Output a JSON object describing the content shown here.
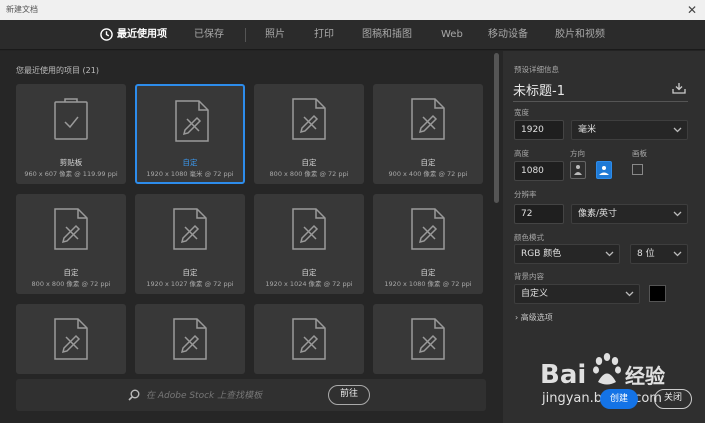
{
  "window": {
    "title": "新建文档"
  },
  "tabs": [
    {
      "label": "最近使用项",
      "active": true
    },
    {
      "label": "已保存"
    },
    {
      "label": "照片"
    },
    {
      "label": "打印"
    },
    {
      "label": "图稿和插图"
    },
    {
      "label": "Web"
    },
    {
      "label": "移动设备"
    },
    {
      "label": "胶片和视频"
    }
  ],
  "recent": {
    "title": "您最近使用的项目",
    "count": "(21)",
    "items": [
      {
        "name": "剪贴板",
        "desc": "960 x 607 像素 @ 119.99 ppi",
        "icon": "clipboard-icon"
      },
      {
        "name": "自定",
        "desc": "1920 x 1080 毫米 @ 72 ppi",
        "icon": "document-icon",
        "selected": true
      },
      {
        "name": "自定",
        "desc": "800 x 800 像素 @ 72 ppi",
        "icon": "document-icon"
      },
      {
        "name": "自定",
        "desc": "900 x 400 像素 @ 72 ppi",
        "icon": "document-icon"
      },
      {
        "name": "自定",
        "desc": "800 x 800 像素 @ 72 ppi",
        "icon": "document-icon"
      },
      {
        "name": "自定",
        "desc": "1920 x 1027 像素 @ 72 ppi",
        "icon": "document-icon"
      },
      {
        "name": "自定",
        "desc": "1920 x 1024 像素 @ 72 ppi",
        "icon": "document-icon"
      },
      {
        "name": "自定",
        "desc": "1920 x 1080 像素 @ 72 ppi",
        "icon": "document-icon"
      },
      {
        "name": "",
        "desc": "",
        "icon": "document-icon"
      },
      {
        "name": "",
        "desc": "",
        "icon": "document-icon"
      },
      {
        "name": "",
        "desc": "",
        "icon": "document-icon"
      },
      {
        "name": "",
        "desc": "",
        "icon": "document-icon"
      }
    ]
  },
  "stock": {
    "placeholder": "在 Adobe Stock 上查找模板",
    "go_label": "前往"
  },
  "preset": {
    "header": "预设详细信息",
    "doc_title": "未标题-1",
    "width_label": "宽度",
    "width_value": "1920",
    "width_unit": "毫米",
    "height_label": "高度",
    "height_value": "1080",
    "orientation_label": "方向",
    "artboard_label": "画板",
    "resolution_label": "分辨率",
    "resolution_value": "72",
    "resolution_unit": "像素/英寸",
    "color_mode_label": "颜色模式",
    "color_mode_value": "RGB 颜色",
    "bit_depth_value": "8 位",
    "background_label": "背景内容",
    "background_value": "自定义",
    "background_color": "#000000",
    "advanced_label": "高级选项"
  },
  "actions": {
    "create_label": "创建",
    "close_label": "关闭"
  },
  "watermark": {
    "text": "jingyan.baidu.com"
  },
  "colors": {
    "accent": "#1473e6",
    "selection": "#2d8ceb"
  }
}
